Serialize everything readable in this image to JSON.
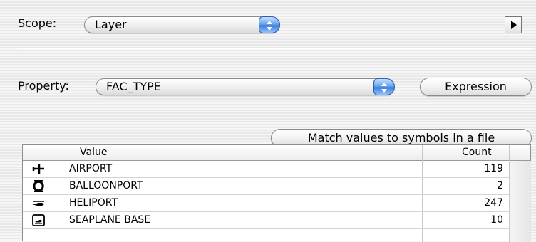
{
  "scope": {
    "label": "Scope:",
    "value": "Layer"
  },
  "property": {
    "label": "Property:",
    "value": "FAC_TYPE"
  },
  "buttons": {
    "expression": "Expression",
    "match": "Match values to symbols in a file"
  },
  "table": {
    "columns": [
      "",
      "Value",
      "Count"
    ],
    "rows": [
      {
        "symbol": "airplane-icon",
        "value": "AIRPORT",
        "count": "119"
      },
      {
        "symbol": "balloon-circle-icon",
        "value": "BALLOONPORT",
        "count": "2"
      },
      {
        "symbol": "helicopter-icon",
        "value": "HELIPORT",
        "count": "247"
      },
      {
        "symbol": "seaplane-icon",
        "value": "SEAPLANE BASE",
        "count": "10"
      }
    ]
  }
}
